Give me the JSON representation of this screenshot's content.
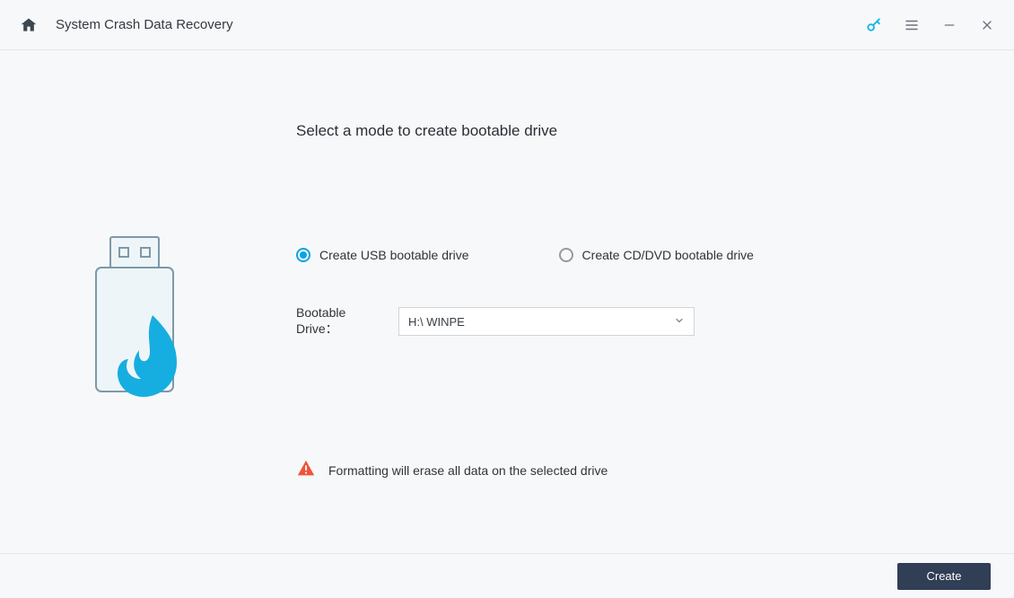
{
  "titlebar": {
    "title": "System Crash Data Recovery"
  },
  "main": {
    "heading": "Select a mode to create bootable drive",
    "option_usb": "Create USB bootable drive",
    "option_cd": "Create CD/DVD bootable drive",
    "selected_option": "usb",
    "drive_label": "Bootable Drive：",
    "drive_selected_value": "H:\\ WINPE",
    "warning_text": "Formatting will erase all data on the selected drive"
  },
  "footer": {
    "create_button": "Create"
  },
  "colors": {
    "accent": "#0aa3e6",
    "button_bg": "#303e56",
    "warning": "#f0533a"
  }
}
